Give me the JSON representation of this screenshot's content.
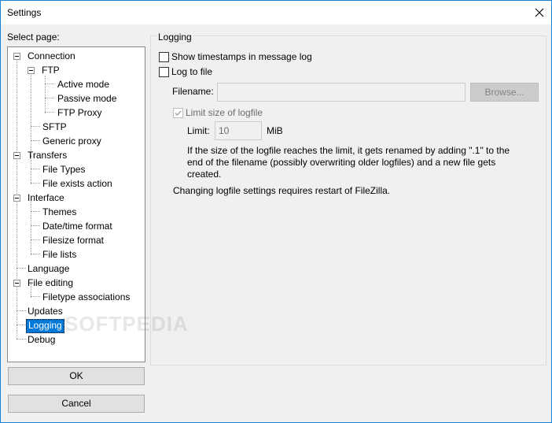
{
  "window": {
    "title": "Settings"
  },
  "sidebar": {
    "label": "Select page:",
    "items": [
      {
        "label": "Connection"
      },
      {
        "label": "FTP"
      },
      {
        "label": "Active mode"
      },
      {
        "label": "Passive mode"
      },
      {
        "label": "FTP Proxy"
      },
      {
        "label": "SFTP"
      },
      {
        "label": "Generic proxy"
      },
      {
        "label": "Transfers"
      },
      {
        "label": "File Types"
      },
      {
        "label": "File exists action"
      },
      {
        "label": "Interface"
      },
      {
        "label": "Themes"
      },
      {
        "label": "Date/time format"
      },
      {
        "label": "Filesize format"
      },
      {
        "label": "File lists"
      },
      {
        "label": "Language"
      },
      {
        "label": "File editing"
      },
      {
        "label": "Filetype associations"
      },
      {
        "label": "Updates"
      },
      {
        "label": "Logging"
      },
      {
        "label": "Debug"
      }
    ],
    "selected": "Logging"
  },
  "buttons": {
    "ok": "OK",
    "cancel": "Cancel"
  },
  "logging": {
    "group_label": "Logging",
    "show_timestamps": "Show timestamps in message log",
    "log_to_file": "Log to file",
    "filename_label": "Filename:",
    "filename_value": "",
    "browse": "Browse...",
    "limit_size": "Limit size of logfile",
    "limit_label": "Limit:",
    "limit_value": "10",
    "limit_unit": "MiB",
    "info_line1": "If the size of the logfile reaches the limit, it gets renamed by adding \".1\" to the",
    "info_line2": "end of the filename (possibly overwriting older logfiles) and a new file gets",
    "info_line3": "created.",
    "restart_note": "Changing logfile settings requires restart of FileZilla."
  },
  "watermark": "SOFTPEDIA"
}
